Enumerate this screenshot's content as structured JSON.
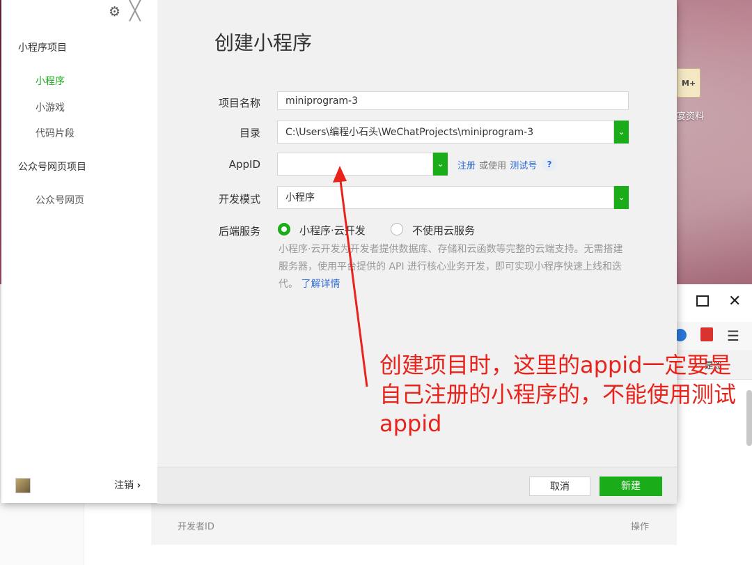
{
  "desktop": {
    "icon_badge": "M+",
    "icon_label": "宴资料"
  },
  "background_window": {
    "bookmarks_text": "是签",
    "table_col_developer_id": "开发者ID",
    "table_col_actions": "操作"
  },
  "sidebar": {
    "section_miniprogram": "小程序项目",
    "items_miniprogram": [
      "小程序",
      "小游戏",
      "代码片段"
    ],
    "section_official": "公众号网页项目",
    "items_official": [
      "公众号网页"
    ],
    "logout_label": "注销",
    "logout_chevron": "›"
  },
  "form": {
    "title": "创建小程序",
    "project_name_label": "项目名称",
    "project_name_value": "miniprogram-3",
    "directory_label": "目录",
    "directory_value": "C:\\Users\\编程小石头\\WeChatProjects\\miniprogram-3",
    "appid_label": "AppID",
    "appid_value": "",
    "register_link": "注册",
    "or_use_text": "或使用",
    "test_account_link": "测试号",
    "help_symbol": "?",
    "dev_mode_label": "开发模式",
    "dev_mode_value": "小程序",
    "backend_label": "后端服务",
    "option_cloud": "小程序·云开发",
    "option_no_cloud": "不使用云服务",
    "backend_description": "小程序·云开发为开发者提供数据库、存储和云函数等完整的云端支持。无需搭建服务器，使用平台提供的 API 进行核心业务开发，即可实现小程序快速上线和迭代。",
    "learn_more_link": "了解详情"
  },
  "footer": {
    "cancel_label": "取消",
    "create_label": "新建"
  },
  "annotation": {
    "text": "创建项目时，这里的appid一定要是自己注册的小程序的，不能使用测试appid",
    "color": "#e8231c"
  },
  "colors": {
    "accent": "#1aad19",
    "link": "#2f6cd6"
  }
}
